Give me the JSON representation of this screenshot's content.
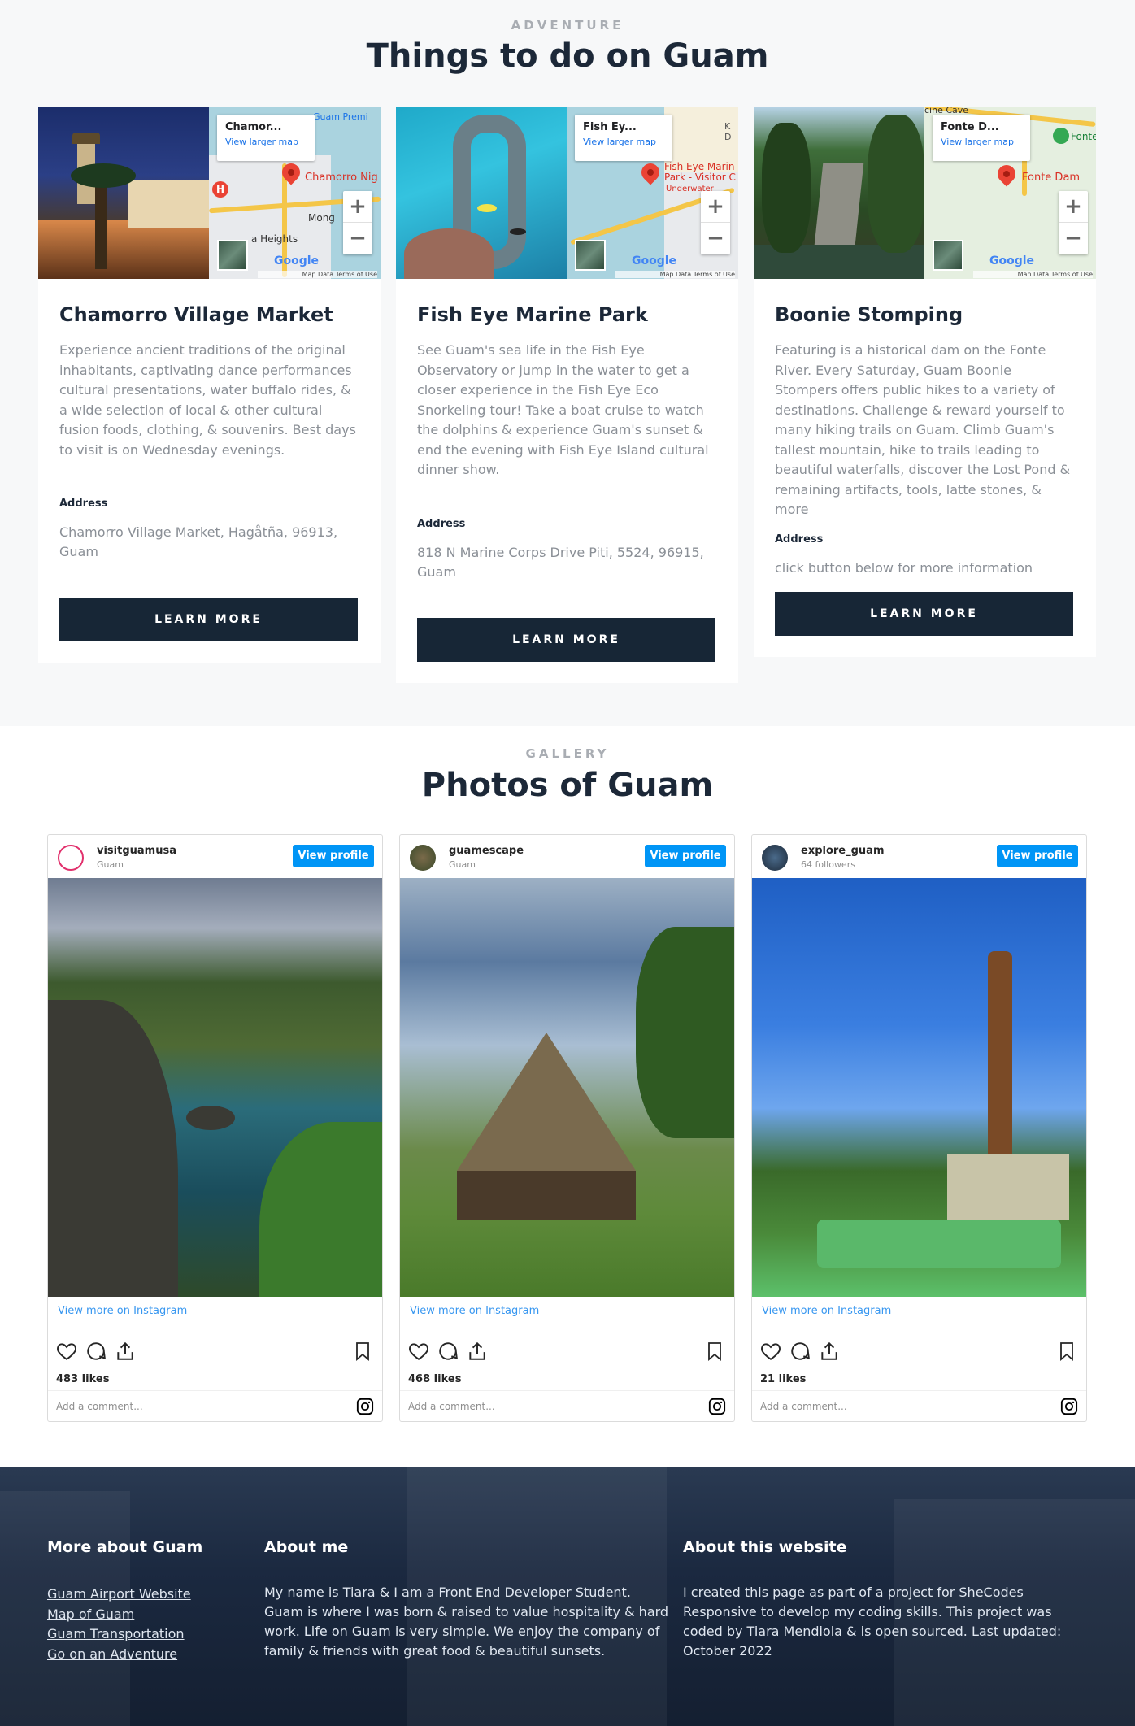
{
  "adventure": {
    "eyebrow": "ADVENTURE",
    "title": "Things to do on Guam",
    "cards": [
      {
        "map_label": "Chamor...",
        "map_link": "View larger map",
        "map_pin_label": "Chamorro Nig",
        "map_place1": "Guam Premi",
        "map_place2": "Mong",
        "map_place3": "a Heights",
        "title": "Chamorro Village Market",
        "desc": "Experience ancient traditions of the original inhabitants, captivating dance performances cultural presentations, water buffalo rides, & a wide selection of local & other cultural fusion foods, clothing, & souvenirs. Best days to visit is on Wednesday evenings.",
        "address_label": "Address",
        "address": "Chamorro Village Market, Hagåtña, 96913, Guam",
        "button": "LEARN MORE"
      },
      {
        "map_label": "Fish Ey...",
        "map_link": "View larger map",
        "map_pin_label": "Fish Eye Marin Park - Visitor C",
        "map_place1": "K D",
        "map_place2": "Underwater",
        "map_place3": "",
        "title": "Fish Eye Marine Park",
        "desc": "See Guam's sea life in the Fish Eye Observatory or jump in the water to get a closer experience in the Fish Eye Eco Snorkeling tour! Take a boat cruise to watch the dolphins & experience Guam's sunset & end the evening with Fish Eye Island cultural dinner show.",
        "address_label": "Address",
        "address": "818 N Marine Corps Drive Piti, 5524, 96915, Guam",
        "button": "LEARN MORE"
      },
      {
        "map_label": "Fonte D...",
        "map_link": "View larger map",
        "map_pin_label": "Fonte Dam",
        "map_place1": "cine Cave",
        "map_place2": "Fonte",
        "map_place3": "",
        "title": "Boonie Stomping",
        "desc": "Featuring is a historical dam on the Fonte River. Every Saturday, Guam Boonie Stompers offers public hikes to a variety of destinations. Challenge & reward yourself to many hiking trails on Guam. Climb Guam's tallest mountain, hike to trails leading to beautiful waterfalls, discover the Lost Pond & remaining artifacts, tools, latte stones, & more",
        "address_label": "Address",
        "address": "click button below for more information",
        "button": "LEARN MORE"
      }
    ],
    "map_common": {
      "google": "Google",
      "footer": "Map Data   Terms of Use",
      "zoom_in": "+",
      "zoom_out": "−"
    }
  },
  "gallery": {
    "eyebrow": "GALLERY",
    "title": "Photos of Guam",
    "posts": [
      {
        "user": "visitguamusa",
        "sub": "Guam",
        "view_profile": "View profile",
        "view_more": "View more on Instagram",
        "likes": "483 likes",
        "comment": "Add a comment..."
      },
      {
        "user": "guamescape",
        "sub": "Guam",
        "view_profile": "View profile",
        "view_more": "View more on Instagram",
        "likes": "468 likes",
        "comment": "Add a comment..."
      },
      {
        "user": "explore_guam",
        "sub": "64 followers",
        "view_profile": "View profile",
        "view_more": "View more on Instagram",
        "likes": "21 likes",
        "comment": "Add a comment..."
      }
    ]
  },
  "footer": {
    "col1_title": "More about Guam",
    "links": [
      "Guam Airport Website",
      "Map of Guam",
      "Guam Transportation",
      "Go on an Adventure"
    ],
    "col2_title": "About me",
    "col2_text": "My name is Tiara & I am a Front End Developer Student. Guam is where I was born & raised to value hospitality & hard work. Life on Guam is very simple. We enjoy the company of family & friends with great food & beautiful sunsets.",
    "col3_title": "About this website",
    "col3_text_a": "I created this page as part of a project for SheCodes Responsive to develop my coding skills. This project was coded by Tiara Mendiola & is ",
    "col3_link": "open sourced.",
    "col3_text_b": " Last updated: October 2022"
  }
}
